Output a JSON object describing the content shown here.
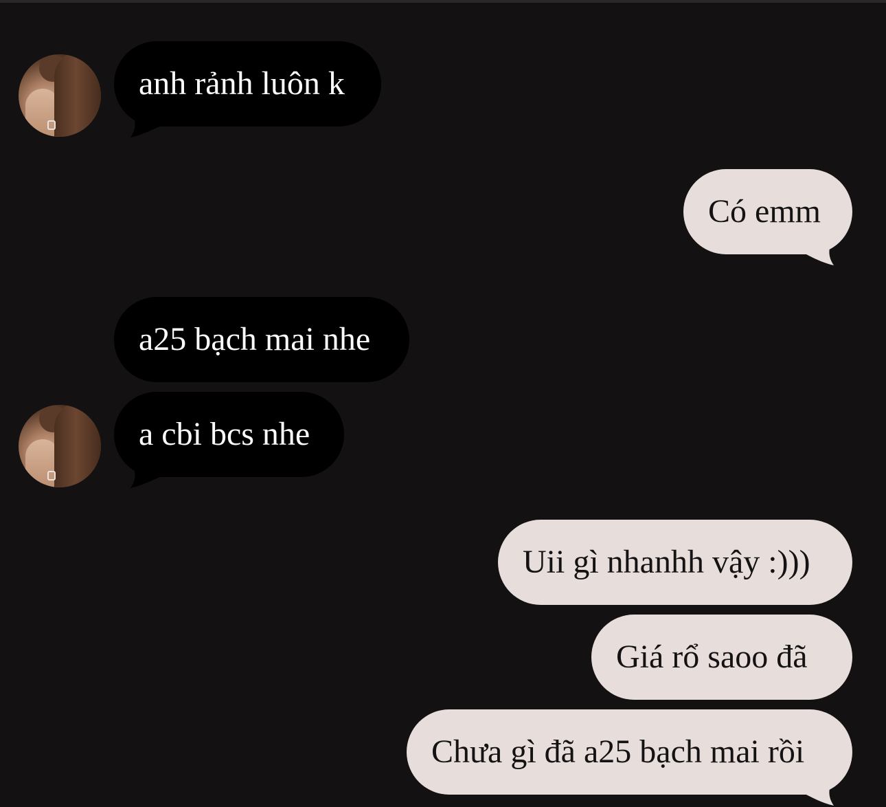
{
  "conversation": {
    "messages": [
      {
        "text": "anh rảnh luôn k",
        "direction": "incoming"
      },
      {
        "text": "Có emm",
        "direction": "outgoing"
      },
      {
        "text": "a25 bạch mai nhe",
        "direction": "incoming"
      },
      {
        "text": "a cbi bcs nhe",
        "direction": "incoming"
      },
      {
        "text": "Uii gì nhanhh vậy :)))",
        "direction": "outgoing"
      },
      {
        "text": "Giá rổ saoo đã",
        "direction": "outgoing"
      },
      {
        "text": "Chưa gì đã a25 bạch mai rồi",
        "direction": "outgoing"
      }
    ]
  },
  "colors": {
    "background": "#131111",
    "incoming_bubble": "#000000",
    "incoming_text": "#ffffff",
    "outgoing_bubble": "#e7dedc",
    "outgoing_text": "#141212"
  }
}
